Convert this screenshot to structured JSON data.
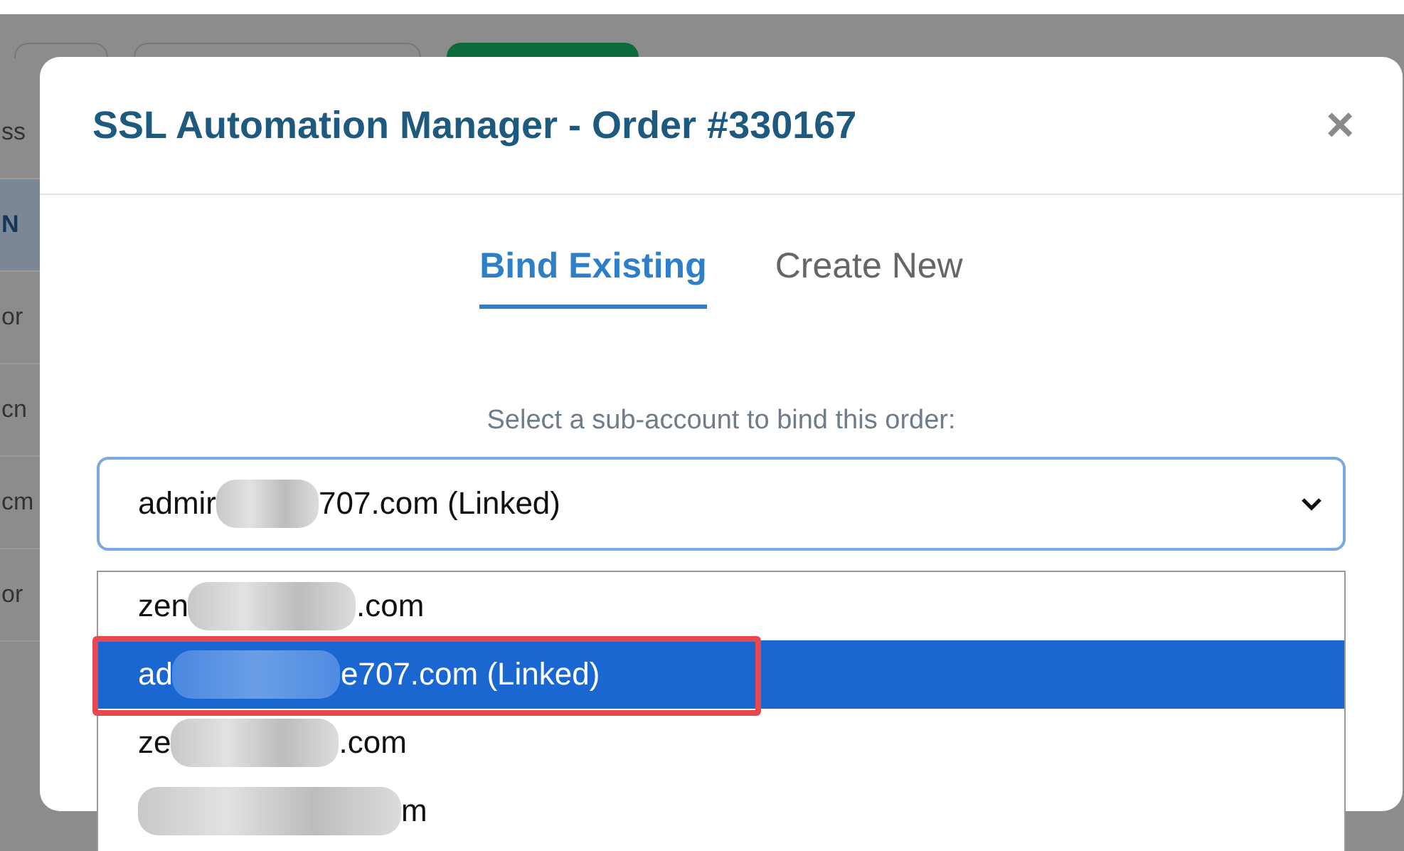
{
  "background": {
    "fragments": [
      "ss",
      "N",
      "or",
      "cn",
      "cm",
      "or"
    ]
  },
  "dialog": {
    "title": "SSL Automation Manager - Order #330167",
    "close": "×",
    "tabs": [
      {
        "label": "Bind Existing",
        "selected": true
      },
      {
        "label": "Create New",
        "selected": false
      }
    ],
    "prompt": "Select a sub-account to bind this order:",
    "select": {
      "value_start": "admir",
      "value_end": "707.com (Linked)",
      "expanded": true
    },
    "options": [
      {
        "start": "zen",
        "end": ".com",
        "selected": false
      },
      {
        "start": "ad",
        "end": "e707.com (Linked)",
        "selected": true
      },
      {
        "start": "ze",
        "end": ".com",
        "selected": false
      },
      {
        "end": "m",
        "selected": false
      }
    ]
  }
}
